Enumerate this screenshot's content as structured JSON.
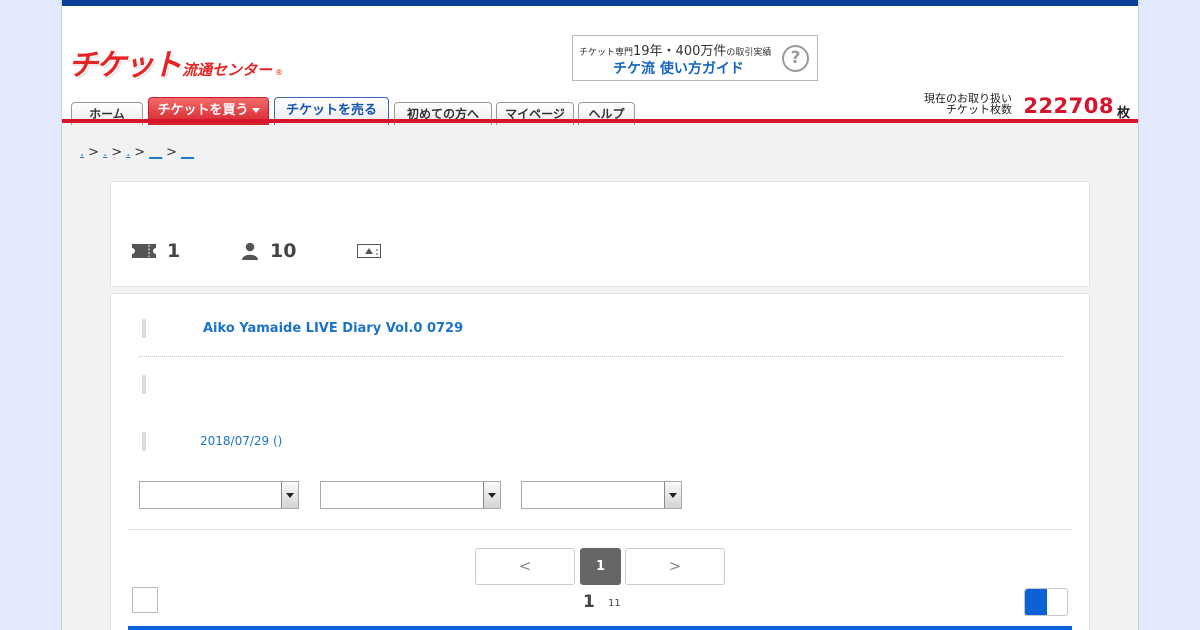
{
  "header": {
    "logo": {
      "main": "チケット",
      "sub": "流通センター",
      "reg": "®"
    },
    "guide": {
      "top_prefix": "チケット専門",
      "top_big": "19年・400万件",
      "top_suffix": "の取引実績",
      "bottom": "チケ流 使い方ガイド",
      "help_glyph": "?"
    },
    "nav": [
      {
        "label": "ホーム"
      },
      {
        "label": "チケットを買う"
      },
      {
        "label": "チケットを売る"
      },
      {
        "label": "初めての方へ"
      },
      {
        "label": "マイページ"
      },
      {
        "label": "ヘルプ"
      }
    ],
    "ticket_count": {
      "label_line1": "現在のお取り扱い",
      "label_line2": "チケット枚数",
      "value": "222708",
      "unit": "枚"
    }
  },
  "breadcrumb": [
    {
      "text": "."
    },
    {
      "text": "."
    },
    {
      "text": "."
    },
    {
      "text": "__"
    },
    {
      "text": "__"
    }
  ],
  "breadcrumb_sep": ">",
  "stats": {
    "tickets": "1",
    "people": "10"
  },
  "event": {
    "title": "Aiko Yamaide LIVE Diary Vol.0 0729",
    "date": "2018/07/29 ()"
  },
  "filters": [
    {
      "value": ""
    },
    {
      "value": ""
    },
    {
      "value": ""
    }
  ],
  "pagination": {
    "prev": "<",
    "current": "1",
    "next": ">",
    "page": "1",
    "total": "11"
  },
  "colors": {
    "brand_red": "#d6142b",
    "brand_blue": "#0b62d6",
    "link": "#1a73c8"
  }
}
